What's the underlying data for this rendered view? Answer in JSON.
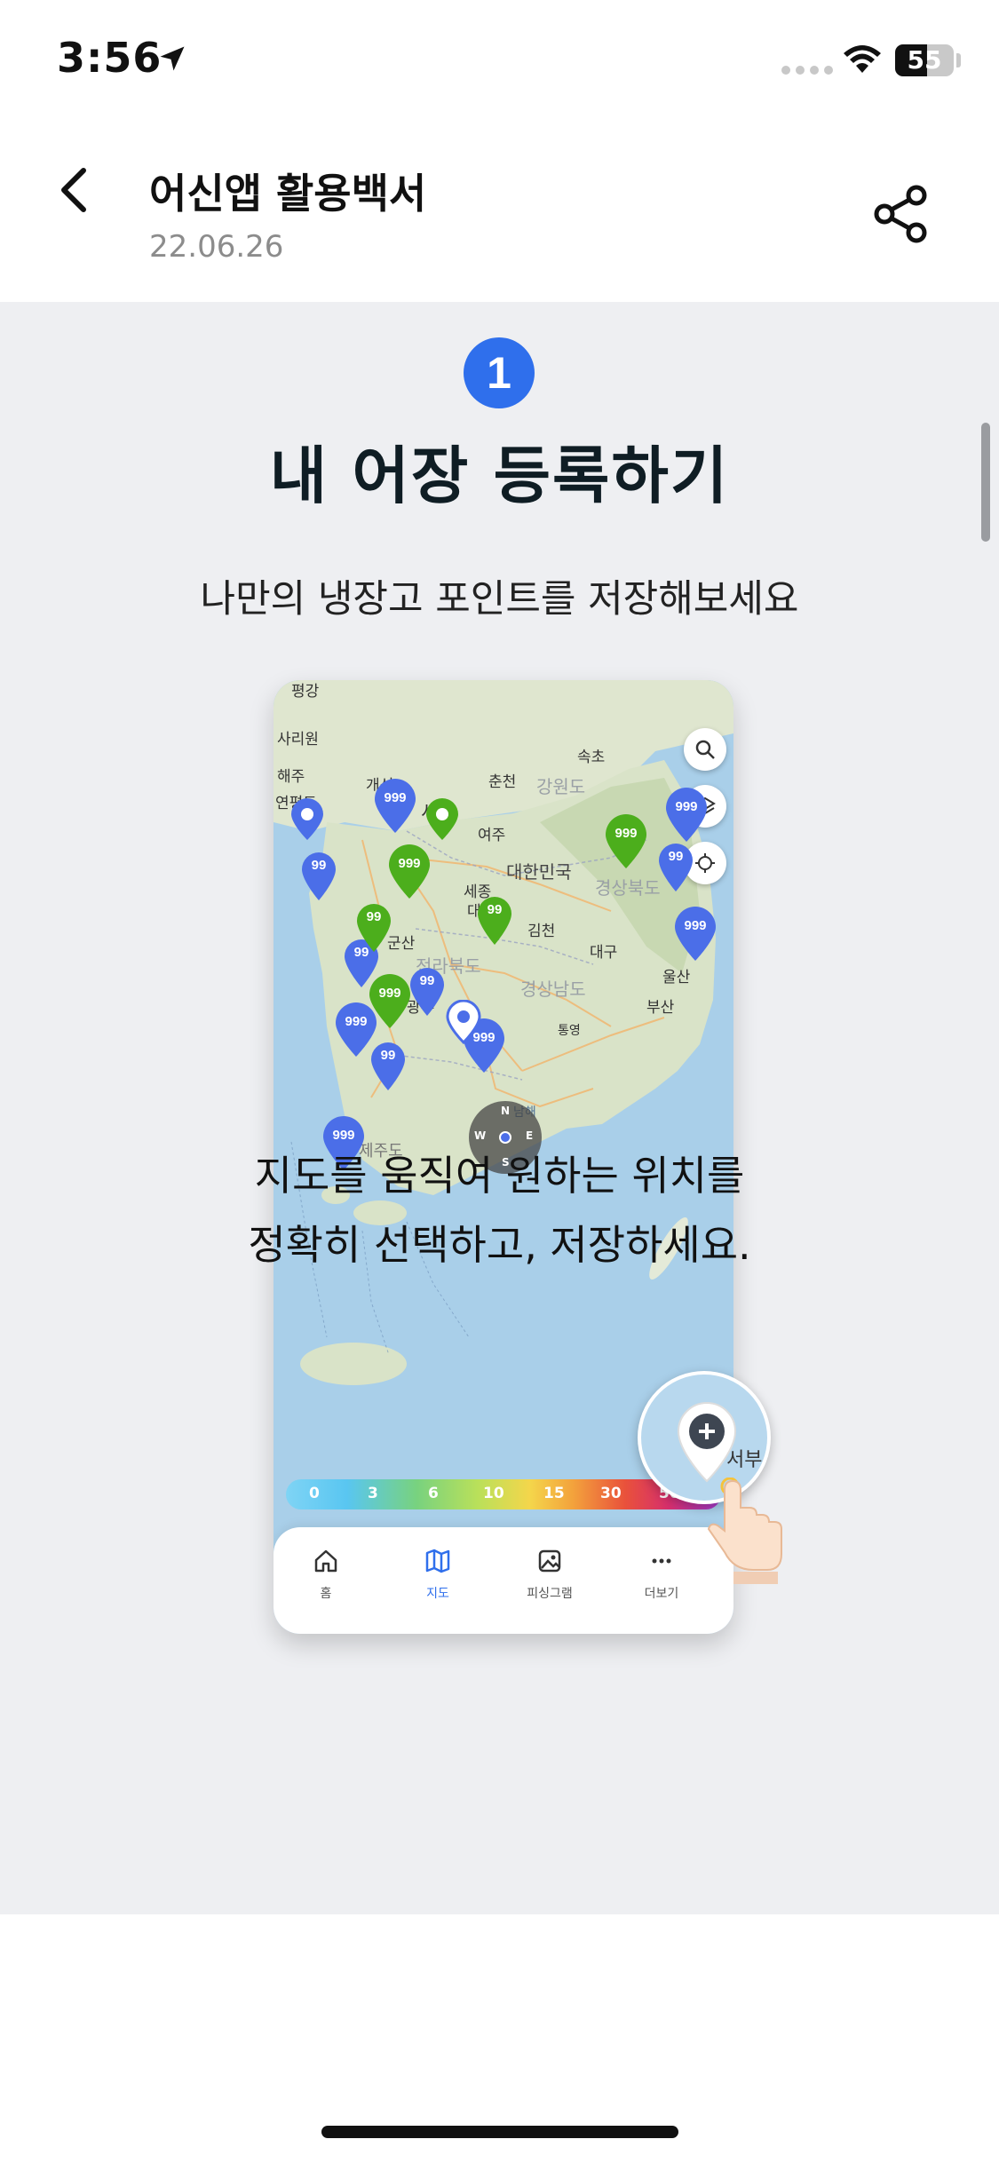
{
  "status_bar": {
    "time": "3:56",
    "battery_level": "55",
    "battery_fraction": 0.55,
    "icons": [
      "location-arrow-icon",
      "cellular-signal-icon",
      "wifi-icon",
      "battery-icon"
    ]
  },
  "header": {
    "title": "어신앱 활용백서",
    "date": "22.06.26",
    "back_icon": "chevron-left-icon",
    "share_icon": "share-icon"
  },
  "step": {
    "number": "1",
    "title": "내 어장 등록하기",
    "subtitle": "나만의 냉장고 포인트를 저장해보세요"
  },
  "mockup": {
    "map_labels": [
      {
        "text": "평강"
      },
      {
        "text": "사리원"
      },
      {
        "text": "해주"
      },
      {
        "text": "개성"
      },
      {
        "text": "연평도"
      },
      {
        "text": "춘천"
      },
      {
        "text": "강원도"
      },
      {
        "text": "속초"
      },
      {
        "text": "서울"
      },
      {
        "text": "여주"
      },
      {
        "text": "동해"
      },
      {
        "text": "대한민국"
      },
      {
        "text": "세종"
      },
      {
        "text": "경상북도"
      },
      {
        "text": "대전"
      },
      {
        "text": "김천"
      },
      {
        "text": "군산"
      },
      {
        "text": "대구"
      },
      {
        "text": "전라북도"
      },
      {
        "text": "울산"
      },
      {
        "text": "경상남도"
      },
      {
        "text": "광주"
      },
      {
        "text": "부산"
      },
      {
        "text": "통영"
      },
      {
        "text": "남해"
      },
      {
        "text": "제주도"
      }
    ],
    "pins": [
      {
        "label": "999",
        "color": "#4b6ee8"
      },
      {
        "label": "99",
        "color": "#4b6ee8"
      },
      {
        "label": "99",
        "color": "#4b6ee8"
      },
      {
        "label": "999",
        "color": "#4b6ee8"
      },
      {
        "label": "999",
        "color": "#4b6ee8"
      },
      {
        "label": "999",
        "color": "#4b6ee8"
      },
      {
        "label": "99",
        "color": "#4b6ee8"
      },
      {
        "label": "99",
        "color": "#4b6ee8"
      },
      {
        "label": "999",
        "color": "#4b6ee8"
      },
      {
        "label": "999",
        "color": "#4b6ee8"
      },
      {
        "label": "99",
        "color": "#4b6ee8"
      },
      {
        "label": "999",
        "color": "#4b6ee8"
      },
      {
        "label": "999",
        "color": "#4cae1c"
      },
      {
        "label": "999",
        "color": "#4cae1c"
      },
      {
        "label": "99",
        "color": "#4cae1c"
      },
      {
        "label": "99",
        "color": "#4cae1c"
      },
      {
        "label": "999",
        "color": "#4cae1c"
      }
    ],
    "compass": {
      "n": "N",
      "e": "E",
      "s": "S",
      "w": "W"
    },
    "wind_scale": [
      "0",
      "3",
      "6",
      "10",
      "15",
      "30",
      "50m/s"
    ],
    "nav": [
      {
        "label": "홈",
        "icon": "home-icon"
      },
      {
        "label": "지도",
        "icon": "map-icon"
      },
      {
        "label": "피싱그램",
        "icon": "image-icon"
      },
      {
        "label": "더보기",
        "icon": "more-icon"
      }
    ],
    "callout_label": "서부"
  },
  "caption": {
    "line1": "지도를 움직여 원하는 위치를",
    "line2": "정확히 선택하고, 저장하세요."
  },
  "colors": {
    "accent": "#2f6fec",
    "pin_blue": "#4b6ee8",
    "pin_green": "#4cae1c",
    "content_bg": "#eeeff2"
  }
}
